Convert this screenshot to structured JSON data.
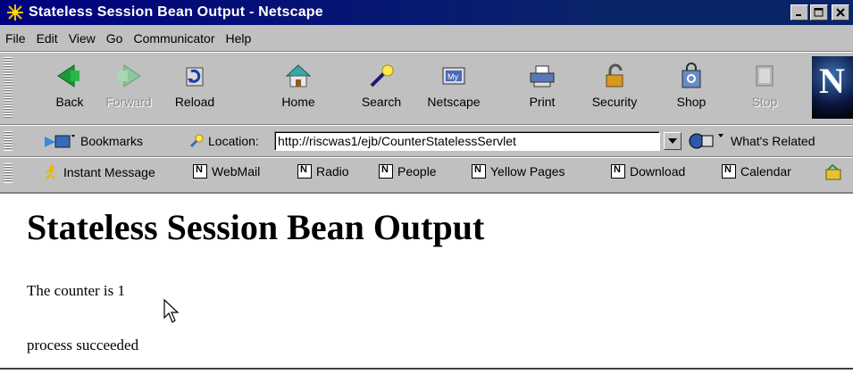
{
  "window": {
    "title": "Stateless Session Bean Output - Netscape",
    "icon": "netscape-app-icon"
  },
  "menu": [
    {
      "label": "File"
    },
    {
      "label": "Edit"
    },
    {
      "label": "View"
    },
    {
      "label": "Go"
    },
    {
      "label": "Communicator"
    },
    {
      "label": "Help"
    }
  ],
  "nav": {
    "back": "Back",
    "forward": "Forward",
    "reload": "Reload",
    "home": "Home",
    "search": "Search",
    "netscape": "Netscape",
    "print": "Print",
    "security": "Security",
    "shop": "Shop",
    "stop": "Stop"
  },
  "location": {
    "bookmarks_label": "Bookmarks",
    "location_label": "Location:",
    "url": "http://riscwas1/ejb/CounterStatelessServlet",
    "whats_related": "What's Related"
  },
  "personal_toolbar": [
    {
      "label": "Instant Message"
    },
    {
      "label": "WebMail"
    },
    {
      "label": "Radio"
    },
    {
      "label": "People"
    },
    {
      "label": "Yellow Pages"
    },
    {
      "label": "Download"
    },
    {
      "label": "Calendar"
    }
  ],
  "page": {
    "heading": "Stateless Session Bean Output",
    "counter_text": "The counter is 1",
    "status_text": "process succeeded"
  }
}
